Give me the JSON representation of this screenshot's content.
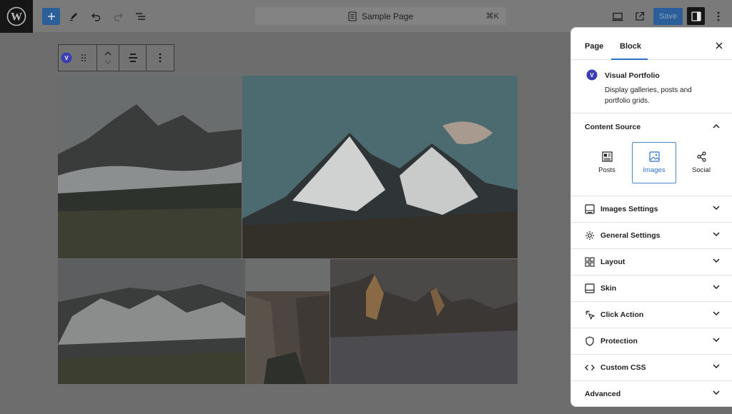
{
  "topbar": {
    "document_title": "Sample Page",
    "shortcut": "⌘K",
    "save_label": "Save",
    "colors": {
      "accent": "#2a5f9a",
      "dark": "#161616"
    }
  },
  "block_toolbar": {
    "block_icon_letter": "V"
  },
  "panel": {
    "tabs": [
      {
        "label": "Page",
        "active": false
      },
      {
        "label": "Block",
        "active": true
      }
    ],
    "block": {
      "name": "Visual Portfolio",
      "icon_letter": "V",
      "description": "Display galleries, posts and portfolio grids."
    },
    "content_source": {
      "heading": "Content Source",
      "options": [
        {
          "label": "Posts",
          "icon": "posts-icon",
          "active": false
        },
        {
          "label": "Images",
          "icon": "images-icon",
          "active": true
        },
        {
          "label": "Social",
          "icon": "share-icon",
          "active": false
        }
      ]
    },
    "sections": [
      {
        "label": "Images Settings",
        "icon": "images-settings-icon"
      },
      {
        "label": "General Settings",
        "icon": "gear-icon"
      },
      {
        "label": "Layout",
        "icon": "layout-icon"
      },
      {
        "label": "Skin",
        "icon": "skin-icon"
      },
      {
        "label": "Click Action",
        "icon": "click-icon"
      },
      {
        "label": "Protection",
        "icon": "shield-icon"
      },
      {
        "label": "Custom CSS",
        "icon": "code-icon"
      },
      {
        "label": "Advanced",
        "icon": ""
      }
    ]
  }
}
